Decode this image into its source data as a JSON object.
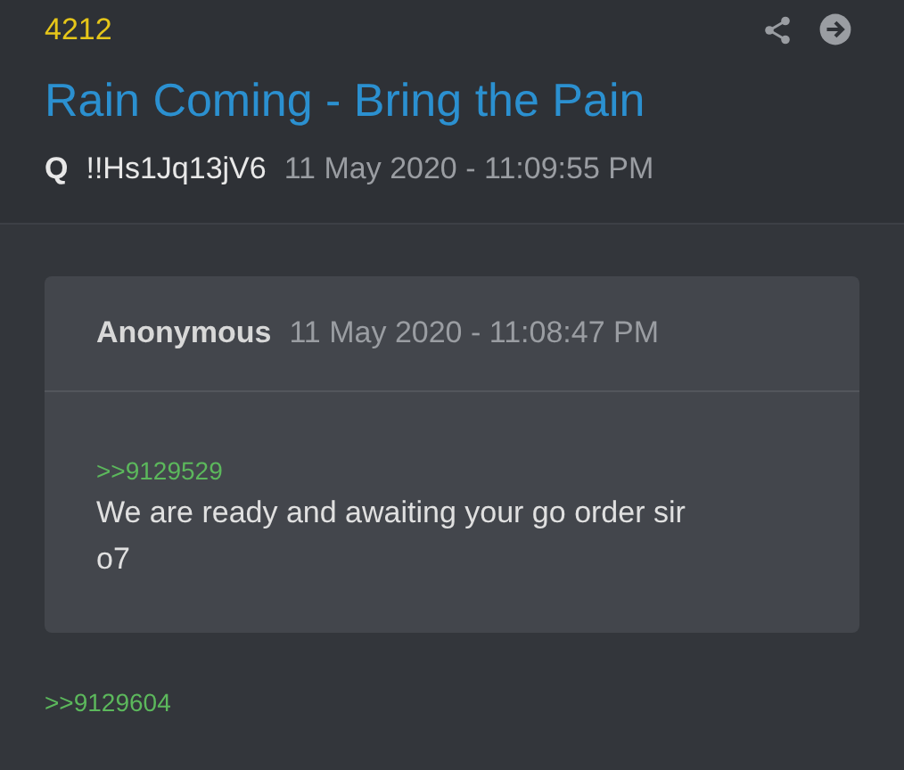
{
  "post": {
    "number": "4212",
    "title": "Rain Coming - Bring the Pain",
    "author": "Q",
    "tripcode": "!!Hs1Jq13jV6",
    "date": "11 May 2020 - 11:09:55 PM"
  },
  "quote": {
    "author": "Anonymous",
    "date": "11 May 2020 - 11:08:47 PM",
    "reference": ">>9129529",
    "lines": [
      "We are ready and awaiting your go order sir",
      "o7"
    ]
  },
  "reference": ">>9129604"
}
